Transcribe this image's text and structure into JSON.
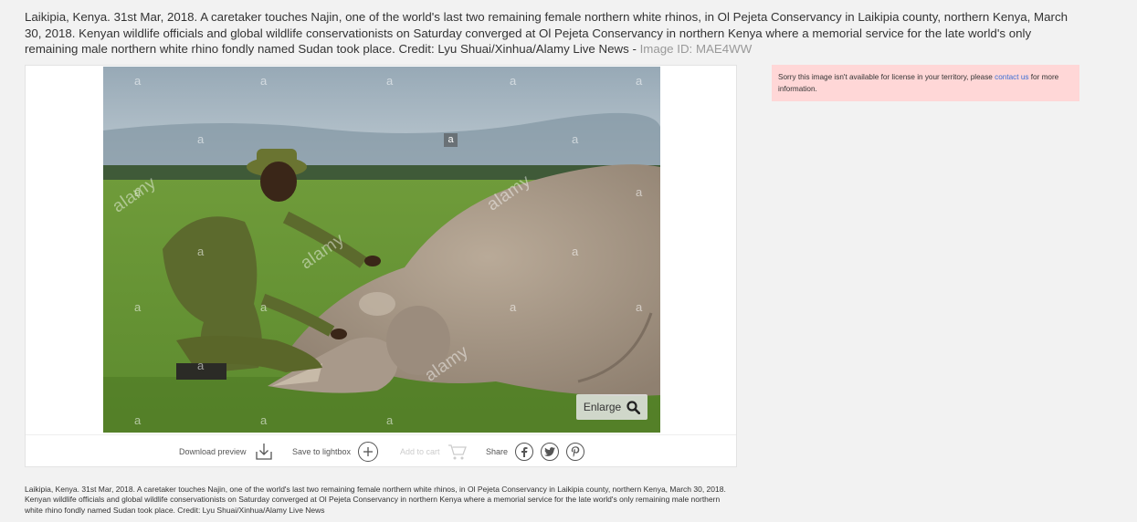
{
  "headline": {
    "text": "Laikipia, Kenya. 31st Mar, 2018. A caretaker touches Najin, one of the world's last two remaining female northern white rhinos, in Ol Pejeta Conservancy in Laikipia county, northern Kenya, March 30, 2018. Kenyan wildlife officials and global wildlife conservationists on Saturday converged at Ol Pejeta Conservancy in northern Kenya where a memorial service for the late world's only remaining male northern white rhino fondly named Sudan took place. Credit: Lyu Shuai/Xinhua/Alamy Live News",
    "separator": " - ",
    "image_id_label": "Image ID: ",
    "image_id": "MAE4WW"
  },
  "photo": {
    "watermark_letter": "a",
    "watermark_brand": "alamy",
    "enlarge_label": "Enlarge"
  },
  "toolbar": {
    "download_label": "Download preview",
    "lightbox_label": "Save to lightbox",
    "cart_label": "Add to cart",
    "share_label": "Share",
    "share_icons": [
      "facebook-icon",
      "twitter-icon",
      "pinterest-icon"
    ]
  },
  "notice": {
    "text_before": "Sorry this image isn't available for license in your territory, please ",
    "link_text": "contact us",
    "text_after": " for more information.",
    "background": "#ffd7d7",
    "link_color": "#3b6fd6"
  },
  "caption": {
    "text": "Laikipia, Kenya. 31st Mar, 2018. A caretaker touches Najin, one of the world's last two remaining female northern white rhinos, in Ol Pejeta Conservancy in Laikipia county, northern Kenya, March 30, 2018. Kenyan wildlife officials and global wildlife conservationists on Saturday converged at Ol Pejeta Conservancy in northern Kenya where a memorial service for the late world's only remaining male northern white rhino fondly named Sudan took place. Credit: Lyu Shuai/Xinhua/Alamy Live News"
  }
}
